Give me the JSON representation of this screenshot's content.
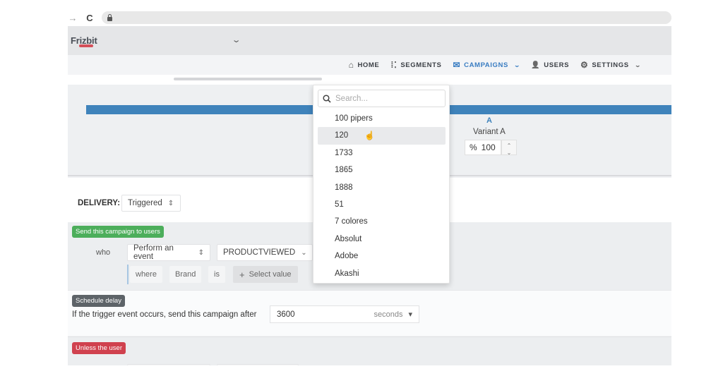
{
  "browser": {
    "back_icon": "→",
    "reload_icon": "C"
  },
  "app": {
    "logo_text": "Frizbit",
    "org_chevron": "⌄"
  },
  "nav": {
    "items": [
      {
        "label": "HOME",
        "icon": "home-icon",
        "glyph": "⌂",
        "active": false,
        "has_chevron": false
      },
      {
        "label": "SEGMENTS",
        "icon": "segments-icon",
        "glyph": "⁞⁚",
        "active": false,
        "has_chevron": false
      },
      {
        "label": "CAMPAIGNS",
        "icon": "envelope-icon",
        "glyph": "✉",
        "active": true,
        "has_chevron": true
      },
      {
        "label": "USERS",
        "icon": "users-icon",
        "glyph": "👤",
        "active": false,
        "has_chevron": false
      },
      {
        "label": "SETTINGS",
        "icon": "gear-icon",
        "glyph": "⚙",
        "active": false,
        "has_chevron": true
      }
    ],
    "chevron": "⌄",
    "accent_color": "#3a7dc2"
  },
  "variants": {
    "split_percent": 100,
    "bar_color": "#3f83bb",
    "items": [
      {
        "letter": "A",
        "name": "Variant A",
        "percent_symbol": "%",
        "percent_value": "100"
      }
    ],
    "spin_up": "⌃",
    "spin_down": "⌄"
  },
  "delivery": {
    "label": "DELIVERY:",
    "value": "Triggered",
    "select_icon": "⇕"
  },
  "send_rule": {
    "badge": "Send this campaign to users",
    "who_label": "who",
    "action_value": "Perform an event",
    "action_icon": "⇕",
    "event_value": "PRODUCTVIEWED",
    "event_chevron": "⌄",
    "where_label": "where",
    "property": "Brand",
    "operator": "is",
    "select_value_icon": "+",
    "select_value_label": "Select value"
  },
  "schedule": {
    "badge": "Schedule delay",
    "text": "If the trigger event occurs, send this campaign after",
    "delay_value": "3600",
    "delay_unit": "seconds",
    "unit_caret": "▾"
  },
  "unless": {
    "badge": "Unless the user"
  },
  "dropdown": {
    "search_placeholder": "Search...",
    "search_value": "",
    "hovered_index": 1,
    "options": [
      "100 pipers",
      "120",
      "1733",
      "1865",
      "1888",
      "51",
      "7 colores",
      "Absolut",
      "Adobe",
      "Akashi"
    ]
  }
}
